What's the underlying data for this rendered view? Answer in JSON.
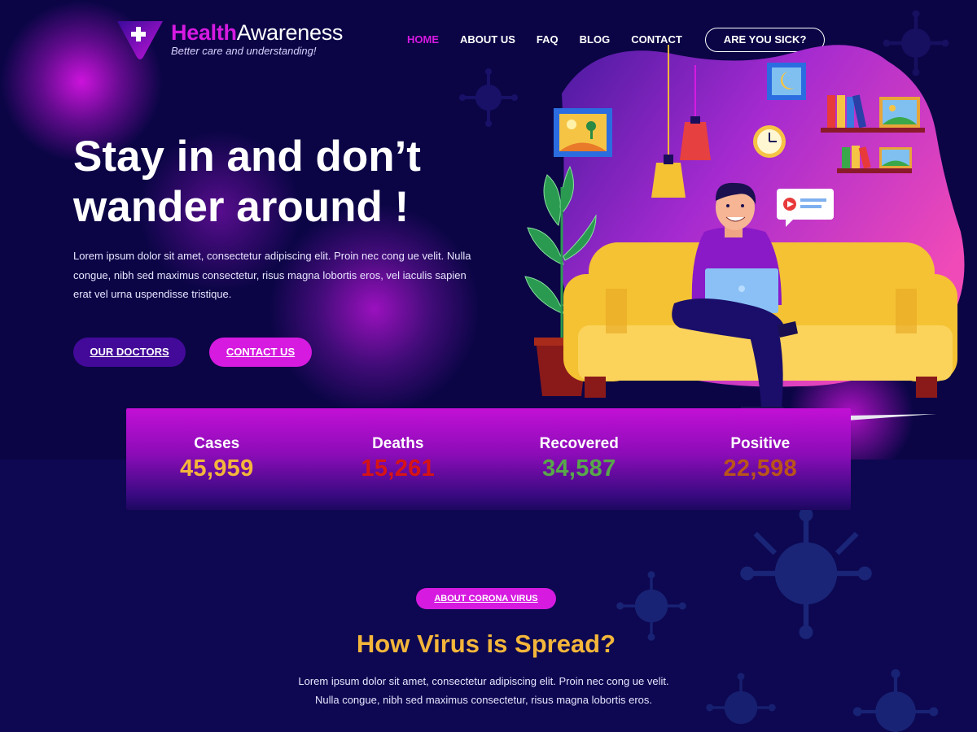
{
  "brand": {
    "name_part1": "Health",
    "name_part2": "Awareness",
    "tagline": "Better care and understanding!"
  },
  "nav": {
    "items": [
      {
        "label": "HOME",
        "active": true
      },
      {
        "label": "ABOUT US",
        "active": false
      },
      {
        "label": "FAQ",
        "active": false
      },
      {
        "label": "BLOG",
        "active": false
      },
      {
        "label": "CONTACT",
        "active": false
      }
    ],
    "cta": "ARE YOU SICK?"
  },
  "hero": {
    "title_line1": "Stay in and don’t",
    "title_line2": "wander around !",
    "text": "Lorem ipsum dolor sit amet, consectetur adipiscing elit. Proin nec cong ue velit. Nulla congue, nibh sed maximus consectetur, risus magna lobortis eros, vel iaculis sapien erat vel urna uspendisse tristique.",
    "primary_button": "OUR DOCTORS",
    "secondary_button": "CONTACT US"
  },
  "stats": [
    {
      "label": "Cases",
      "value": "45,959",
      "color": "#f4b63a"
    },
    {
      "label": "Deaths",
      "value": "15,261",
      "color": "#d71414"
    },
    {
      "label": "Recovered",
      "value": "34,587",
      "color": "#58a84a"
    },
    {
      "label": "Positive",
      "value": "22,598",
      "color": "#b9541a"
    }
  ],
  "about": {
    "pill": "ABOUT CORONA VIRUS",
    "title": "How Virus is Spread?",
    "text": "Lorem ipsum dolor sit amet, consectetur adipiscing elit. Proin nec cong ue velit. Nulla congue, nibh sed maximus consectetur, risus magna lobortis eros."
  },
  "colors": {
    "background": "#0b0546",
    "accent": "#d61ae0",
    "button_dark": "#430a99",
    "heading_yellow": "#f4b63a"
  },
  "icons": [
    "logo-plus-icon",
    "virus-icon"
  ]
}
